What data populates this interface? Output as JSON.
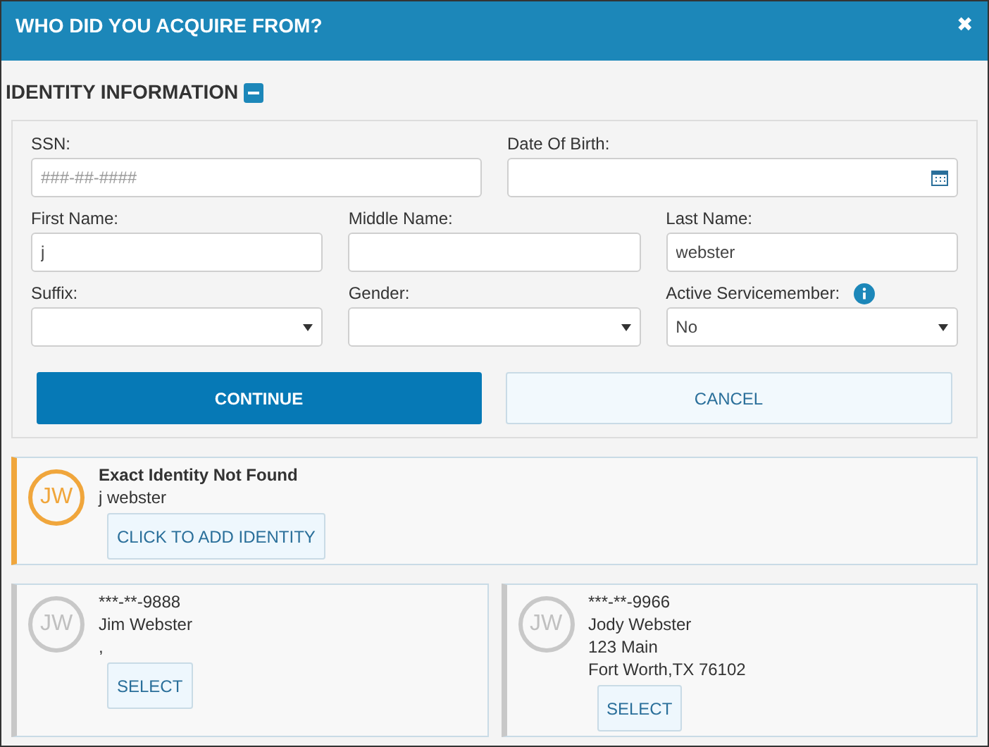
{
  "dialog": {
    "title": "WHO DID YOU ACQUIRE FROM?",
    "close": "✖"
  },
  "section": {
    "title": "IDENTITY INFORMATION",
    "expanded": true
  },
  "form": {
    "rows": [
      [
        {
          "label": "SSN:",
          "kind": "text",
          "placeholder": "###-##-####"
        },
        {
          "label": "Date Of Birth:",
          "kind": "date"
        }
      ],
      [
        {
          "label": "First Name:",
          "kind": "text",
          "value": "j"
        },
        {
          "label": "Middle Name:",
          "kind": "text"
        },
        {
          "label": "Last Name:",
          "kind": "text",
          "value": "webster"
        }
      ],
      [
        {
          "label": "Suffix:",
          "kind": "select"
        },
        {
          "label": "Gender:",
          "kind": "select"
        },
        {
          "label": "Active Servicemember:",
          "kind": "select",
          "value": "No",
          "info": true
        }
      ]
    ],
    "buttons": [
      {
        "label": "CONTINUE",
        "kind": "primary"
      },
      {
        "label": "CANCEL",
        "kind": "secondary"
      }
    ]
  },
  "results": [
    {
      "kind": "exact",
      "initials": "JW",
      "title": "Exact Identity Not Found",
      "lines": [
        "j webster"
      ],
      "action": "CLICK TO ADD IDENTITY"
    },
    {
      "kind": "candidate",
      "initials": "JW",
      "lines": [
        "***-**-9888",
        "Jim Webster",
        ","
      ],
      "action": "SELECT"
    },
    {
      "kind": "candidate",
      "initials": "JW",
      "lines": [
        "***-**-9966",
        "Jody Webster",
        "123 Main",
        "Fort Worth,TX 76102"
      ],
      "action": "SELECT"
    }
  ]
}
